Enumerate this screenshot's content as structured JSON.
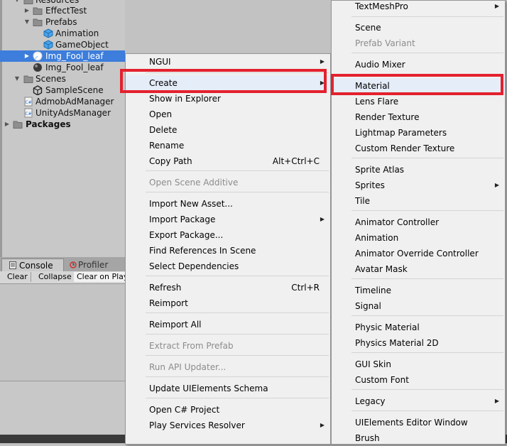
{
  "project": {
    "rows": [
      {
        "label": "Resources"
      },
      {
        "label": "EffectTest"
      },
      {
        "label": "Prefabs"
      },
      {
        "label": "Animation"
      },
      {
        "label": "GameObject"
      },
      {
        "label": "Img_Fool_leaf"
      },
      {
        "label": "Img_Fool_leaf"
      },
      {
        "label": "Scenes"
      },
      {
        "label": "SampleScene"
      },
      {
        "label": "AdmobAdManager"
      },
      {
        "label": "UnityAdsManager"
      },
      {
        "label": "Packages"
      }
    ]
  },
  "console": {
    "tabs": [
      "Console",
      "Profiler"
    ],
    "buttons": [
      "Clear",
      "Collapse",
      "Clear on Play"
    ]
  },
  "context_menu": {
    "items": [
      {
        "label": "NGUI",
        "shortcut": "",
        "submenu": true
      },
      {
        "label": "Create",
        "shortcut": "",
        "submenu": true
      },
      {
        "label": "Show in Explorer",
        "shortcut": ""
      },
      {
        "label": "Open",
        "shortcut": ""
      },
      {
        "label": "Delete",
        "shortcut": ""
      },
      {
        "label": "Rename",
        "shortcut": ""
      },
      {
        "label": "Copy Path",
        "shortcut": "Alt+Ctrl+C"
      },
      {
        "label": "Open Scene Additive",
        "shortcut": "",
        "disabled": true
      },
      {
        "label": "Import New Asset...",
        "shortcut": ""
      },
      {
        "label": "Import Package",
        "shortcut": "",
        "submenu": true
      },
      {
        "label": "Export Package...",
        "shortcut": ""
      },
      {
        "label": "Find References In Scene",
        "shortcut": ""
      },
      {
        "label": "Select Dependencies",
        "shortcut": ""
      },
      {
        "label": "Refresh",
        "shortcut": "Ctrl+R"
      },
      {
        "label": "Reimport",
        "shortcut": ""
      },
      {
        "label": "Reimport All",
        "shortcut": ""
      },
      {
        "label": "Extract From Prefab",
        "shortcut": "",
        "disabled": true
      },
      {
        "label": "Run API Updater...",
        "shortcut": "",
        "disabled": true
      },
      {
        "label": "Update UIElements Schema",
        "shortcut": ""
      },
      {
        "label": "Open C# Project",
        "shortcut": ""
      },
      {
        "label": "Play Services Resolver",
        "shortcut": "",
        "submenu": true
      }
    ]
  },
  "create_submenu": {
    "items": [
      {
        "label": "TextMeshPro",
        "submenu": true
      },
      {
        "label": "Scene"
      },
      {
        "label": "Prefab Variant",
        "disabled": true
      },
      {
        "label": "Audio Mixer"
      },
      {
        "label": "Material"
      },
      {
        "label": "Lens Flare"
      },
      {
        "label": "Render Texture"
      },
      {
        "label": "Lightmap Parameters"
      },
      {
        "label": "Custom Render Texture"
      },
      {
        "label": "Sprite Atlas"
      },
      {
        "label": "Sprites",
        "submenu": true
      },
      {
        "label": "Tile"
      },
      {
        "label": "Animator Controller"
      },
      {
        "label": "Animation"
      },
      {
        "label": "Animator Override Controller"
      },
      {
        "label": "Avatar Mask"
      },
      {
        "label": "Timeline"
      },
      {
        "label": "Signal"
      },
      {
        "label": "Physic Material"
      },
      {
        "label": "Physics Material 2D"
      },
      {
        "label": "GUI Skin"
      },
      {
        "label": "Custom Font"
      },
      {
        "label": "Legacy",
        "submenu": true
      },
      {
        "label": "UIElements Editor Window"
      },
      {
        "label": "Brush"
      }
    ]
  },
  "submenu_arrow": "▶",
  "colors": {
    "selection": "#3d7ddb",
    "highlight_box": "#e3212e",
    "menu_bg": "#f0f0f0",
    "disabled_text": "#8c8c8c"
  }
}
